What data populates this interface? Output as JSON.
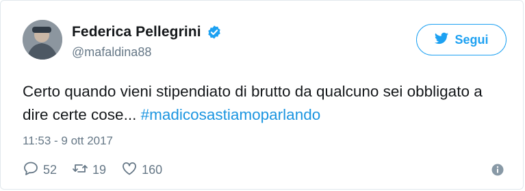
{
  "tweet": {
    "author": {
      "name": "Federica Pellegrini",
      "handle": "@mafaldina88"
    },
    "follow_label": "Segui",
    "text_main": "Certo quando vieni stipendiato di brutto da qualcuno sei obbligato a dire certe cose... ",
    "hashtag": "#madicosastiamoparlando",
    "timestamp": "11:53 - 9 ott 2017",
    "counts": {
      "replies": "52",
      "retweets": "19",
      "likes": "160"
    }
  },
  "colors": {
    "accent": "#1da1f2",
    "hashtag": "#1b95e0",
    "muted": "#657786",
    "text": "#14171a"
  },
  "icons": [
    "verified-badge-icon",
    "twitter-bird-icon",
    "reply-icon",
    "retweet-icon",
    "like-icon",
    "info-icon"
  ]
}
